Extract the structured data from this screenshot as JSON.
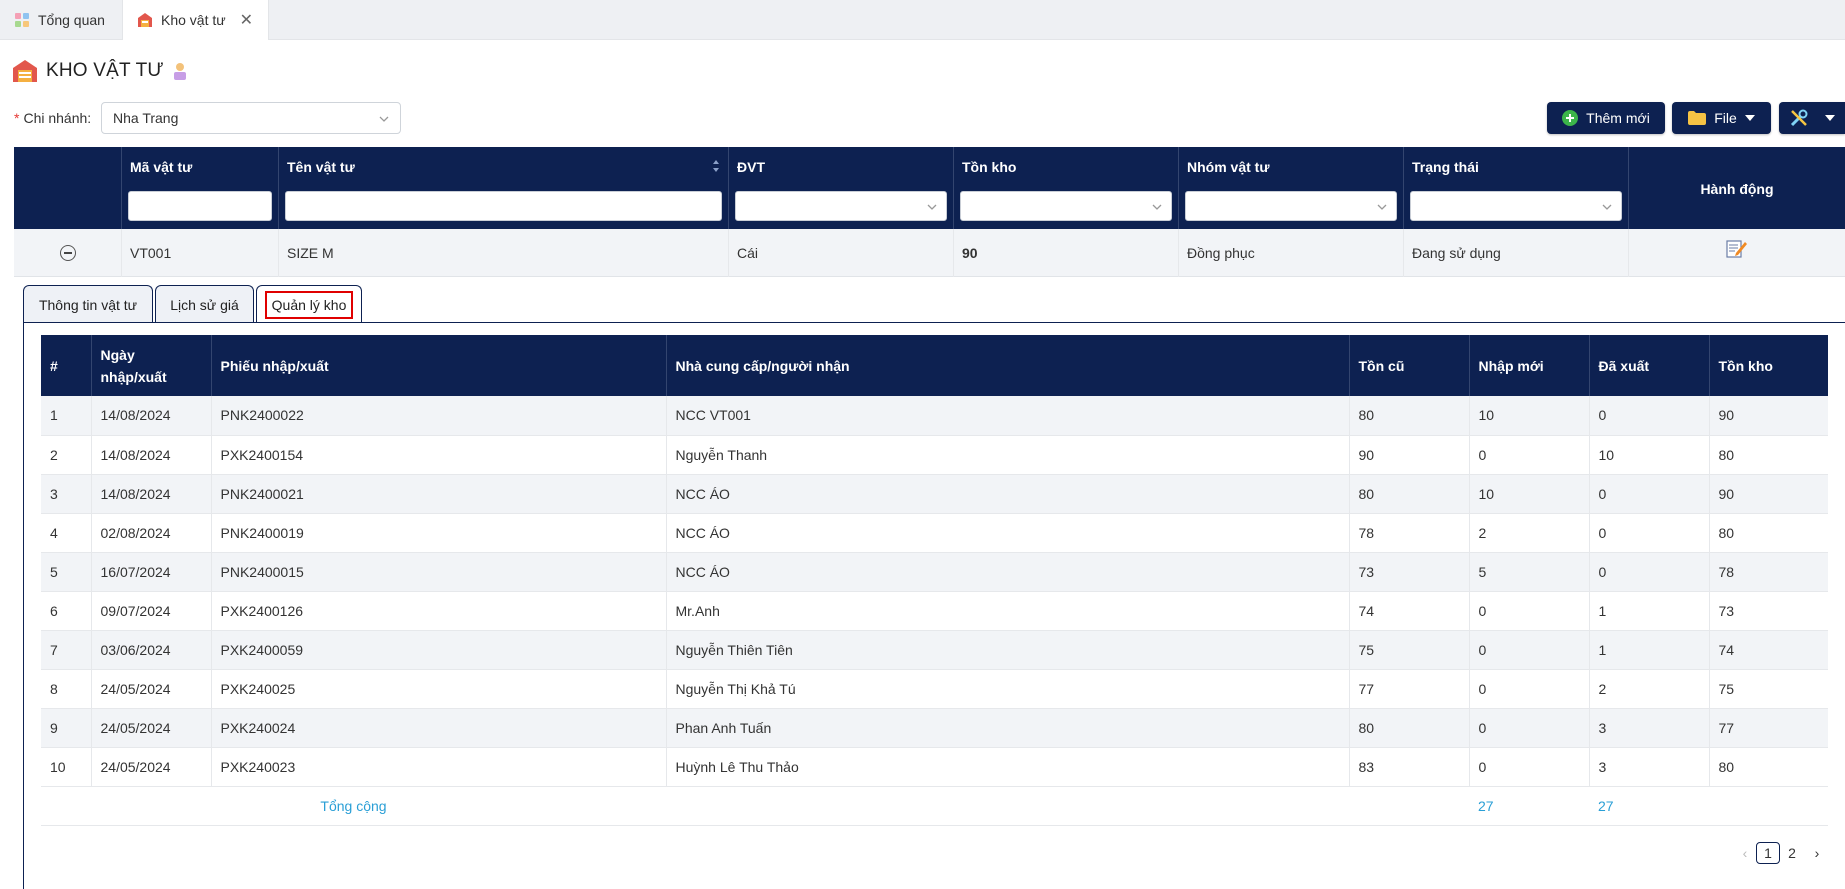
{
  "tabs": [
    {
      "label": "Tổng quan",
      "icon": "dashboard-icon"
    },
    {
      "label": "Kho vật tư",
      "icon": "warehouse-icon",
      "active": true
    }
  ],
  "page": {
    "title": "KHO VẬT TƯ"
  },
  "branch": {
    "label": "Chi nhánh:",
    "required_mark": "*",
    "value": "Nha Trang"
  },
  "toolbar": {
    "add_label": "Thêm mới",
    "file_label": "File"
  },
  "grid": {
    "columns": [
      "Mã vật tư",
      "Tên vật tư",
      "ĐVT",
      "Tồn kho",
      "Nhóm vật tư",
      "Trạng thái",
      "Hành động"
    ],
    "row": {
      "code": "VT001",
      "name": "SIZE M",
      "unit": "Cái",
      "stock": "90",
      "group": "Đồng phục",
      "status": "Đang sử dụng"
    }
  },
  "detail_tabs": [
    "Thông tin vật tư",
    "Lịch sử giá",
    "Quản lý kho"
  ],
  "detail_table": {
    "headers": [
      "#",
      "Ngày nhập/xuất",
      "Phiếu nhập/xuất",
      "Nhà cung cấp/người nhận",
      "Tồn cũ",
      "Nhập mới",
      "Đã xuất",
      "Tồn kho"
    ],
    "rows": [
      [
        "1",
        "14/08/2024",
        "PNK2400022",
        "NCC VT001",
        "80",
        "10",
        "0",
        "90"
      ],
      [
        "2",
        "14/08/2024",
        "PXK2400154",
        "Nguyễn Thanh",
        "90",
        "0",
        "10",
        "80"
      ],
      [
        "3",
        "14/08/2024",
        "PNK2400021",
        "NCC ÁO",
        "80",
        "10",
        "0",
        "90"
      ],
      [
        "4",
        "02/08/2024",
        "PNK2400019",
        "NCC ÁO",
        "78",
        "2",
        "0",
        "80"
      ],
      [
        "5",
        "16/07/2024",
        "PNK2400015",
        "NCC ÁO",
        "73",
        "5",
        "0",
        "78"
      ],
      [
        "6",
        "09/07/2024",
        "PXK2400126",
        "Mr.Anh",
        "74",
        "0",
        "1",
        "73"
      ],
      [
        "7",
        "03/06/2024",
        "PXK2400059",
        "Nguyễn Thiên Tiên",
        "75",
        "0",
        "1",
        "74"
      ],
      [
        "8",
        "24/05/2024",
        "PXK240025",
        "Nguyễn Thị Khả Tú",
        "77",
        "0",
        "2",
        "75"
      ],
      [
        "9",
        "24/05/2024",
        "PXK240024",
        "Phan Anh Tuấn",
        "80",
        "0",
        "3",
        "77"
      ],
      [
        "10",
        "24/05/2024",
        "PXK240023",
        "Huỳnh Lê Thu Thảo",
        "83",
        "0",
        "3",
        "80"
      ]
    ],
    "total": {
      "label": "Tổng cộng",
      "import": "27",
      "export": "27"
    }
  },
  "pagination": {
    "pages": [
      "1",
      "2"
    ],
    "current": "1",
    "prev": "‹",
    "next": "›"
  }
}
